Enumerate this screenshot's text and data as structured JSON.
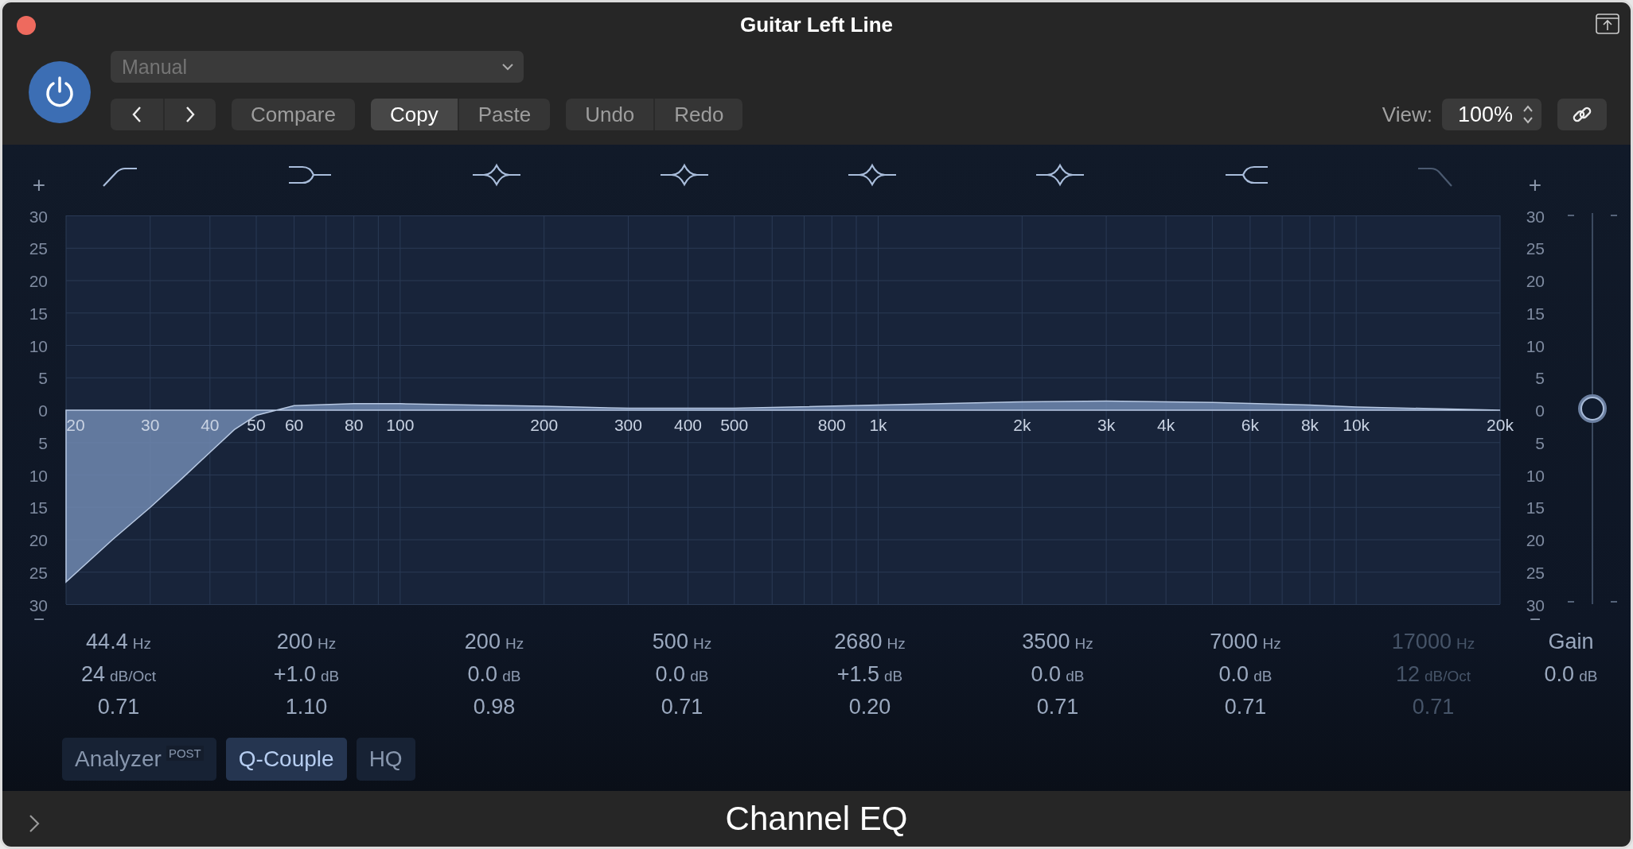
{
  "window": {
    "title": "Guitar Left Line"
  },
  "toolbar": {
    "power": {
      "on": true
    },
    "preset": {
      "value": "Manual",
      "disabled": true
    },
    "groups": [
      [
        {
          "label": "Compare",
          "active": false
        }
      ],
      [
        {
          "label": "Copy",
          "active": true
        },
        {
          "label": "Paste",
          "active": false
        }
      ],
      [
        {
          "label": "Undo",
          "active": false
        },
        {
          "label": "Redo",
          "active": false
        }
      ]
    ],
    "view": {
      "label": "View:",
      "value": "100%"
    }
  },
  "graph": {
    "left_scale": {
      "plus": "+",
      "minus": "−"
    },
    "right_scale": {
      "plus": "+",
      "minus": "−"
    },
    "frequency_labels": [
      "20",
      "30",
      "40",
      "50",
      "60",
      "80",
      "100",
      "200",
      "300",
      "400",
      "500",
      "800",
      "1k",
      "2k",
      "3k",
      "4k",
      "6k",
      "8k",
      "10k",
      "20k"
    ],
    "left_db_labels": [
      "30",
      "25",
      "20",
      "15",
      "10",
      "5",
      "0",
      "5",
      "10",
      "15",
      "20",
      "25",
      "30"
    ],
    "right_db_labels": [
      "30",
      "25",
      "20",
      "15",
      "10",
      "5",
      "0",
      "5",
      "10",
      "15",
      "20",
      "25",
      "30"
    ]
  },
  "bands": [
    {
      "kind": "low_cut",
      "enabled": true,
      "frequency": "44.4",
      "frequency_unit": "Hz",
      "gain": "24",
      "gain_unit": "dB/Oct",
      "q": "0.71"
    },
    {
      "kind": "low_shelf",
      "enabled": true,
      "frequency": "200",
      "frequency_unit": "Hz",
      "gain": "+1.0",
      "gain_unit": "dB",
      "q": "1.10"
    },
    {
      "kind": "bell",
      "enabled": true,
      "frequency": "200",
      "frequency_unit": "Hz",
      "gain": "0.0",
      "gain_unit": "dB",
      "q": "0.98"
    },
    {
      "kind": "bell",
      "enabled": true,
      "frequency": "500",
      "frequency_unit": "Hz",
      "gain": "0.0",
      "gain_unit": "dB",
      "q": "0.71"
    },
    {
      "kind": "bell",
      "enabled": true,
      "frequency": "2680",
      "frequency_unit": "Hz",
      "gain": "+1.5",
      "gain_unit": "dB",
      "q": "0.20"
    },
    {
      "kind": "bell",
      "enabled": true,
      "frequency": "3500",
      "frequency_unit": "Hz",
      "gain": "0.0",
      "gain_unit": "dB",
      "q": "0.71"
    },
    {
      "kind": "high_shelf",
      "enabled": true,
      "frequency": "7000",
      "frequency_unit": "Hz",
      "gain": "0.0",
      "gain_unit": "dB",
      "q": "0.71"
    },
    {
      "kind": "high_cut",
      "enabled": false,
      "frequency": "17000",
      "frequency_unit": "Hz",
      "gain": "12",
      "gain_unit": "dB/Oct",
      "q": "0.71"
    }
  ],
  "gain": {
    "label": "Gain",
    "value": "0.0",
    "unit": "dB",
    "level": 0.5
  },
  "toggles": [
    {
      "label": "Analyzer",
      "badge": "POST",
      "on": false
    },
    {
      "label": "Q-Couple",
      "on": true
    },
    {
      "label": "HQ",
      "on": false
    }
  ],
  "footer": {
    "title": "Channel EQ"
  }
}
